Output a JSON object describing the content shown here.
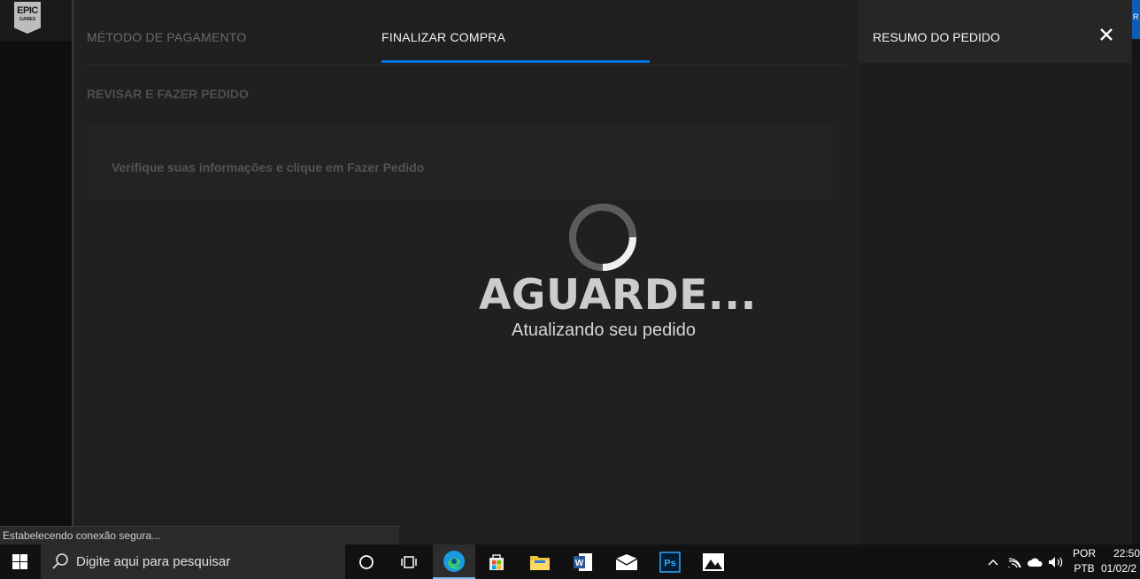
{
  "app": {
    "logo_text_main": "EPIC",
    "logo_text_sub": "GAMES"
  },
  "checkout": {
    "tabs": [
      {
        "label": "MÉTODO DE PAGAMENTO",
        "active": false
      },
      {
        "label": "FINALIZAR COMPRA",
        "active": true
      }
    ],
    "section_title": "REVISAR E FAZER PEDIDO",
    "info_text": "Verifique suas informações e clique em Fazer Pedido"
  },
  "loading": {
    "title": "AGUARDE...",
    "subtitle": "Atualizando seu pedido"
  },
  "summary": {
    "title": "RESUMO DO PEDIDO",
    "close_icon": "close-icon"
  },
  "browser": {
    "status_text": "Estabelecendo conexão segura...",
    "edge_letter": "R"
  },
  "taskbar": {
    "search_placeholder": "Digite aqui para pesquisar",
    "language_line1": "POR",
    "language_line2": "PTB",
    "time": "22:50",
    "date": "01/02/2",
    "accent_color": "#76b9ed"
  },
  "colors": {
    "tab_active_underline": "#0074e4",
    "panel_bg": "#202020"
  }
}
